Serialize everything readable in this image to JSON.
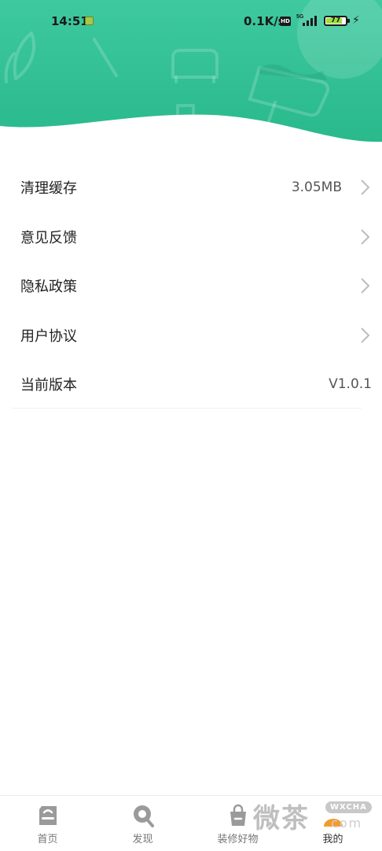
{
  "status_bar": {
    "time": "14:51",
    "network_speed": "0.1K/s",
    "hd_label": "HD",
    "signal_label": "5G",
    "battery_level": "77"
  },
  "menu": {
    "items": [
      {
        "label": "清理缓存",
        "value": "3.05MB",
        "has_chevron": true
      },
      {
        "label": "意见反馈",
        "value": "",
        "has_chevron": true
      },
      {
        "label": "隐私政策",
        "value": "",
        "has_chevron": true
      },
      {
        "label": "用户协议",
        "value": "",
        "has_chevron": true
      },
      {
        "label": "当前版本",
        "value": "V1.0.1",
        "has_chevron": false
      }
    ]
  },
  "tabbar": {
    "tabs": [
      {
        "label": "首页",
        "icon": "home-icon"
      },
      {
        "label": "发现",
        "icon": "search-icon"
      },
      {
        "label": "装修好物",
        "icon": "shopping-bag-icon"
      },
      {
        "label": "我的",
        "icon": "profile-icon"
      }
    ],
    "active_index": 3
  },
  "watermark": {
    "text": "微茶",
    "badge": "WXCHA",
    "suffix": ".com"
  },
  "colors": {
    "header_top": "#2fc99c",
    "header_bottom": "#4fd0a4",
    "accent_orange": "#f39a2d"
  }
}
